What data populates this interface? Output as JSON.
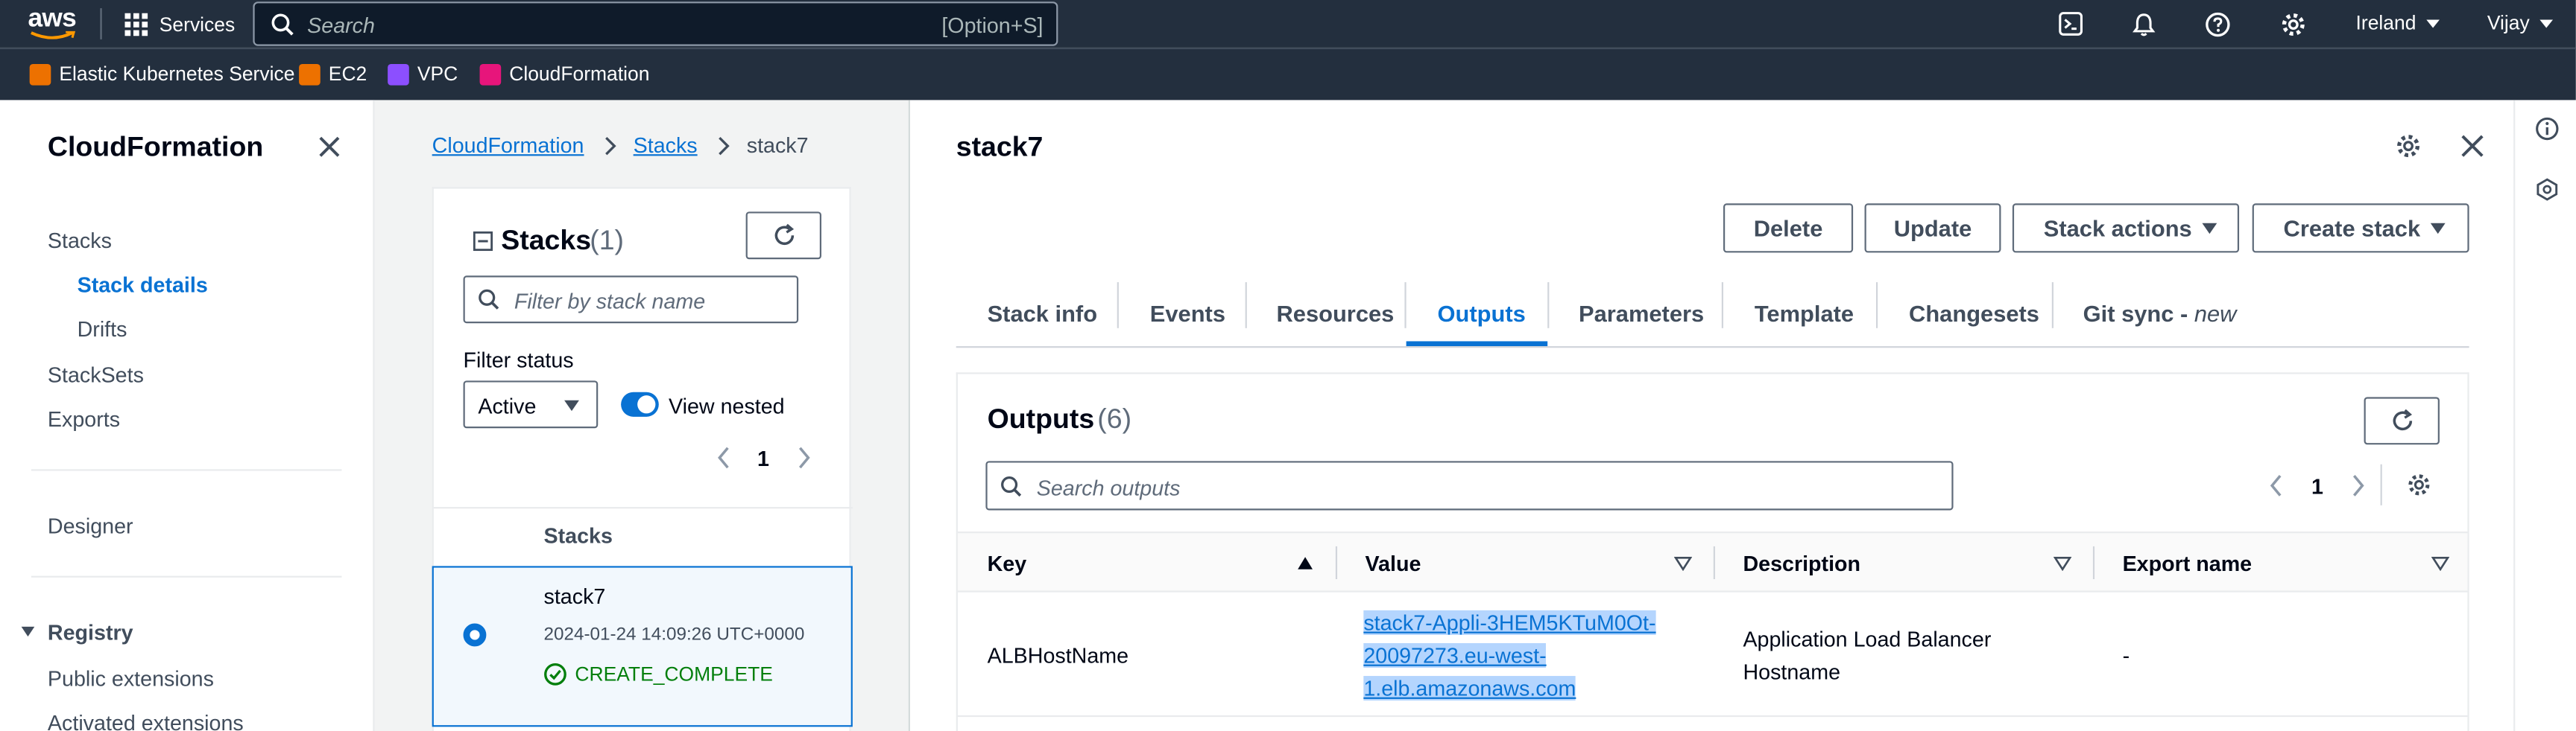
{
  "topbar": {
    "logo": "aws",
    "services_label": "Services",
    "search_placeholder": "Search",
    "search_shortcut": "[Option+S]",
    "region": "Ireland",
    "user": "Vijay"
  },
  "favorites": [
    {
      "label": "Elastic Kubernetes Service",
      "color": "#ed7100"
    },
    {
      "label": "EC2",
      "color": "#ed7100"
    },
    {
      "label": "VPC",
      "color": "#8c4fff"
    },
    {
      "label": "CloudFormation",
      "color": "#e7157b"
    }
  ],
  "sidenav": {
    "title": "CloudFormation",
    "stacks": "Stacks",
    "stack_details": "Stack details",
    "drifts": "Drifts",
    "stacksets": "StackSets",
    "exports": "Exports",
    "designer": "Designer",
    "registry": "Registry",
    "public_extensions": "Public extensions",
    "activated_extensions": "Activated extensions"
  },
  "breadcrumb": {
    "item1": "CloudFormation",
    "item2": "Stacks",
    "current": "stack7"
  },
  "stacks_panel": {
    "title": "Stacks",
    "count": "(1)",
    "filter_placeholder": "Filter by stack name",
    "filter_status_label": "Filter status",
    "filter_status_value": "Active",
    "view_nested_label": "View nested",
    "page": "1",
    "column_header": "Stacks",
    "row": {
      "name": "stack7",
      "date": "2024-01-24 14:09:26 UTC+0000",
      "status": "CREATE_COMPLETE"
    }
  },
  "detail": {
    "title": "stack7",
    "buttons": {
      "delete": "Delete",
      "update": "Update",
      "stack_actions": "Stack actions",
      "create_stack": "Create stack"
    },
    "tabs": {
      "stack_info": "Stack info",
      "events": "Events",
      "resources": "Resources",
      "outputs": "Outputs",
      "parameters": "Parameters",
      "template": "Template",
      "changesets": "Changesets",
      "git_sync": "Git sync - ",
      "git_sync_new": "new"
    },
    "outputs": {
      "title": "Outputs",
      "count": "(6)",
      "search_placeholder": "Search outputs",
      "page": "1",
      "columns": {
        "key": "Key",
        "value": "Value",
        "description": "Description",
        "export_name": "Export name"
      },
      "row": {
        "key": "ALBHostName",
        "value_line1": "stack7-Appli-3HEM5KTuM0Ot-",
        "value_line2": "20097273.eu-west-",
        "value_line3": "1.elb.amazonaws.com",
        "description_line1": "Application Load Balancer",
        "description_line2": "Hostname",
        "export_name": "-"
      }
    }
  },
  "colors": {
    "topbar": "#232f3e",
    "link": "#0972d3",
    "success": "#037f0c",
    "highlight": "#b4d5fe"
  }
}
